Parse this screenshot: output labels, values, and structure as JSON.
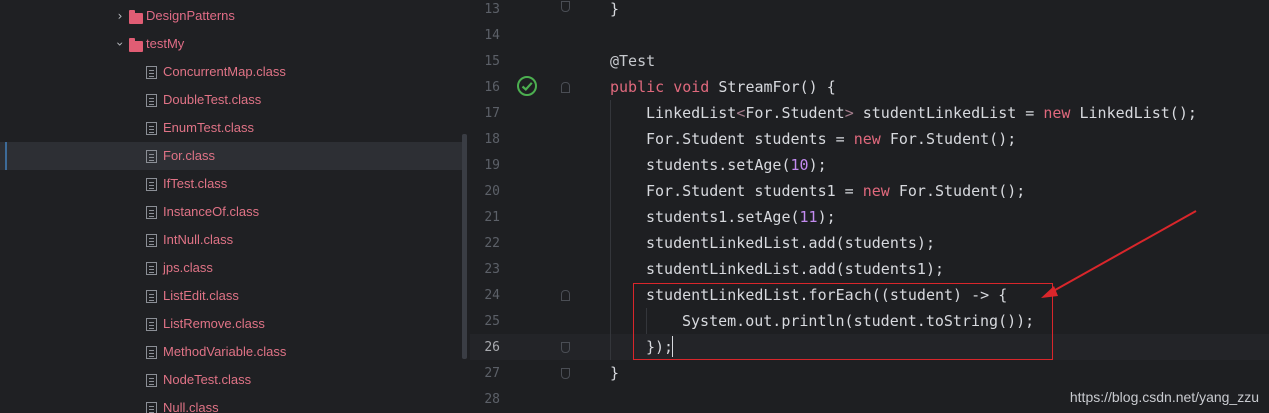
{
  "project_tree": {
    "items": [
      {
        "label": "DesignPatterns",
        "kind": "folder",
        "expanded": false
      },
      {
        "label": "testMy",
        "kind": "folder",
        "expanded": true
      },
      {
        "label": "ConcurrentMap.class",
        "kind": "class"
      },
      {
        "label": "DoubleTest.class",
        "kind": "class"
      },
      {
        "label": "EnumTest.class",
        "kind": "class"
      },
      {
        "label": "For.class",
        "kind": "class",
        "selected": true
      },
      {
        "label": "IfTest.class",
        "kind": "class"
      },
      {
        "label": "InstanceOf.class",
        "kind": "class"
      },
      {
        "label": "IntNull.class",
        "kind": "class"
      },
      {
        "label": "jps.class",
        "kind": "class"
      },
      {
        "label": "ListEdit.class",
        "kind": "class"
      },
      {
        "label": "ListRemove.class",
        "kind": "class"
      },
      {
        "label": "MethodVariable.class",
        "kind": "class"
      },
      {
        "label": "NodeTest.class",
        "kind": "class"
      },
      {
        "label": "Null.class",
        "kind": "class"
      }
    ]
  },
  "editor": {
    "line_numbers": [
      "13",
      "14",
      "15",
      "16",
      "17",
      "18",
      "19",
      "20",
      "21",
      "22",
      "23",
      "24",
      "25",
      "26",
      "27",
      "28"
    ],
    "current_line": "26",
    "lines": {
      "l13": "}",
      "l15": "@Test",
      "l16_kw": "public void",
      "l16_rest": " StreamFor() {",
      "l17_a": "LinkedList",
      "l17_gen1": "<",
      "l17_b": "For.Student",
      "l17_gen2": ">",
      "l17_c": " studentLinkedList = ",
      "l17_kw": "new",
      "l17_d": " LinkedList();",
      "l18_a": "For.Student students = ",
      "l18_kw": "new",
      "l18_b": " For.Student();",
      "l19_a": "students.setAge(",
      "l19_num": "10",
      "l19_b": ");",
      "l20_a": "For.Student students1 = ",
      "l20_kw": "new",
      "l20_b": " For.Student();",
      "l21_a": "students1.setAge(",
      "l21_num": "11",
      "l21_b": ");",
      "l22": "studentLinkedList.add(students);",
      "l23": "studentLinkedList.add(students1);",
      "l24": "studentLinkedList.forEach((student) -> {",
      "l25": "System.out.println(student.toString());",
      "l26": "});",
      "l27": "}"
    }
  },
  "watermark": "https://blog.csdn.net/yang_zzu",
  "colors": {
    "keyword": "#e0697d",
    "number": "#c38bf0",
    "highlight_box": "#d9262b",
    "run_icon": "#4caf50"
  }
}
